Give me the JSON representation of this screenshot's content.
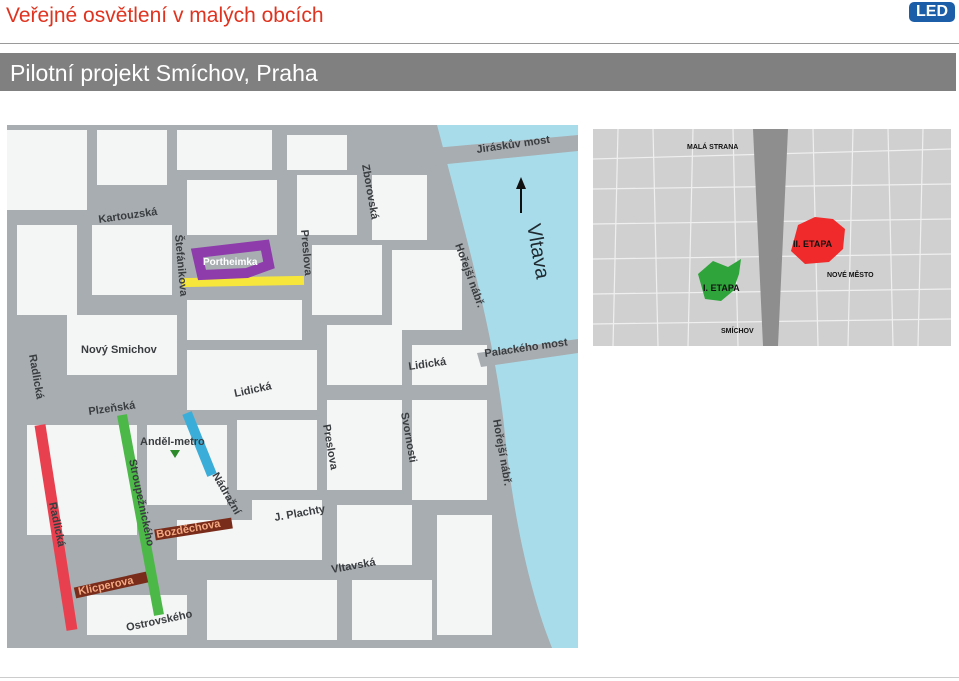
{
  "header": {
    "title": "Veřejné osvětlení v malých obcích",
    "logo_text": "LED"
  },
  "subheader": {
    "title": "Pilotní projekt Smíchov, Praha"
  },
  "main_map": {
    "labels": {
      "kartouzska": "Kartouzská",
      "stefanikova": "Štefánikova",
      "preslova_top": "Preslova",
      "zborovska": "Zborovská",
      "jiraskuv_most": "Jiráskův most",
      "vltava": "Vltava",
      "horejsi_nabr_top": "Hořejší nábř.",
      "portheimka": "Portheimka",
      "novy_smichov": "Nový Smichov",
      "radlicka_left": "Radlická",
      "lidicka_mid": "Lidická",
      "lidicka_right": "Lidická",
      "palackeho_most": "Palackého most",
      "plzenska": "Plzeňská",
      "andel_metro": "Anděl-metro",
      "preslova_bottom": "Preslova",
      "svornosti": "Svornosti",
      "horejsi_nabr_bottom": "Hořejší nábř.",
      "stroupeznickeho": "Stroupežnického",
      "nadrazni": "Nádražní",
      "radlicka_bottom": "Radlická",
      "j_plachty": "J. Plachty",
      "bozdechova": "Bozděchova",
      "klicperova": "Klicperova",
      "vltavska": "Vltavská",
      "ostrovskeho": "Ostrovského"
    },
    "colors": {
      "water": "#a9dcea",
      "street": "#a7adb1",
      "block": "#ffffff",
      "yellow": "#f6e63c",
      "purple": "#8e3cab",
      "red": "#e9404f",
      "green": "#4cb848",
      "blue": "#3aaed8",
      "brown": "#7a2c1a"
    }
  },
  "overview_map": {
    "labels": {
      "mala_strana": "MALÁ STRANA",
      "nove_mesto": "NOVÉ MĚSTO",
      "smichov": "SMÍCHOV",
      "etapa_1": "I. ETAPA",
      "etapa_2": "II. ETAPA"
    },
    "colors": {
      "green": "#2ea43a",
      "red": "#f02a2a"
    }
  }
}
